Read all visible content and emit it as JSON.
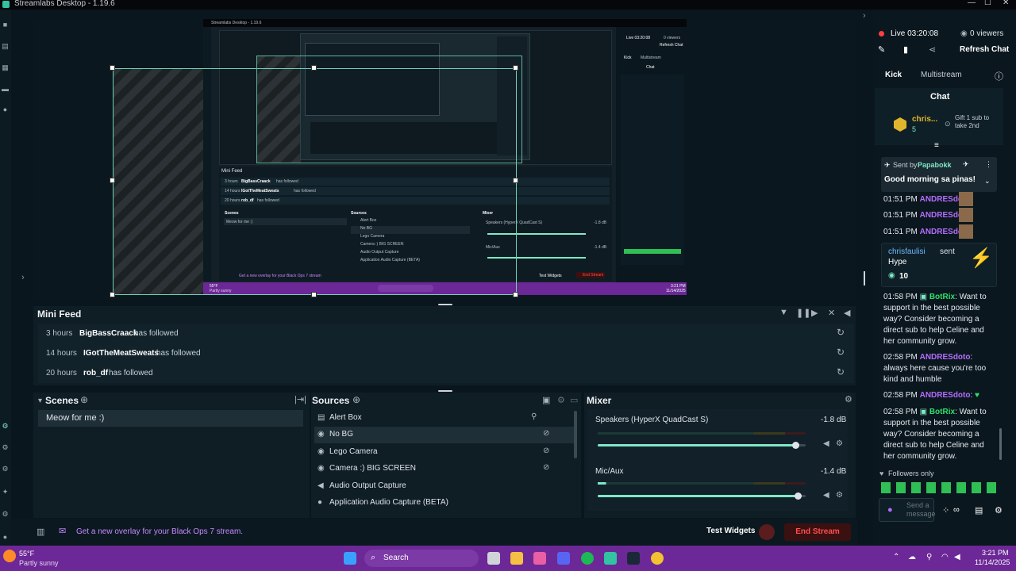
{
  "window": {
    "title": "Streamlabs Desktop - 1.19.6",
    "minimize": "—",
    "maximize": "☐",
    "close": "✕"
  },
  "left_nav": [
    "video-camera",
    "layout",
    "store",
    "themes",
    "monitor"
  ],
  "preview_mini": {
    "title": "Streamlabs Desktop - 1.19.6",
    "mini_feed": "Mini Feed",
    "rows": [
      {
        "time": "3 hours",
        "name": "BigBassCraack",
        "action": "has followed"
      },
      {
        "time": "14 hours",
        "name": "IGotTheMeatSweats",
        "action": "has followed"
      },
      {
        "time": "20 hours",
        "name": "rob_df",
        "action": "has followed"
      }
    ],
    "scenes": "Scenes",
    "scene_item": "Meow for me :)",
    "sources": "Sources",
    "source_items": [
      "Alert Box",
      "No BG",
      "Lego Camera",
      "Camera :) BIG SCREEN",
      "Audio Output Capture",
      "Application Audio Capture (BETA)"
    ],
    "mixer": "Mixer",
    "speakers": "Speakers (HyperX QuadCast S)",
    "speakers_db": "-1.8 dB",
    "mic": "Mic/Aux",
    "mic_db": "-1.4 dB",
    "promo": "Get a new overlay for your Black Ops 7 stream",
    "test_widgets": "Test Widgets",
    "end_stream": "End Stream",
    "live": "Live 03:20:08",
    "viewers": "0 viewers",
    "refresh": "Refresh Chat",
    "kick": "Kick",
    "multistream": "Multistream",
    "chat": "Chat",
    "weather": "55°F",
    "weather_desc": "Partly sunny",
    "clock_time": "3:21 PM",
    "clock_date": "11/14/2025"
  },
  "mini_feed": {
    "title": "Mini Feed",
    "rows": [
      {
        "time": "3 hours",
        "name": "BigBassCraack",
        "action": "has followed"
      },
      {
        "time": "14 hours",
        "name": "IGotTheMeatSweats",
        "action": "has followed"
      },
      {
        "time": "20 hours",
        "name": "rob_df",
        "action": "has followed"
      }
    ]
  },
  "scenes": {
    "title": "Scenes",
    "items": [
      "Meow for me :)"
    ]
  },
  "sources": {
    "title": "Sources",
    "items": [
      "Alert Box",
      "No BG",
      "Lego Camera",
      "Camera :) BIG SCREEN",
      "Audio Output Capture",
      "Application Audio Capture (BETA)"
    ]
  },
  "mixer": {
    "title": "Mixer",
    "channels": [
      {
        "name": "Speakers (HyperX QuadCast S)",
        "db": "-1.8 dB",
        "level": 0.95
      },
      {
        "name": "Mic/Aux",
        "db": "-1.4 dB",
        "level": 0.96
      }
    ]
  },
  "bottom": {
    "promo": "Get a new overlay for your Black Ops 7 stream.",
    "test_widgets": "Test Widgets",
    "end_stream": "End Stream"
  },
  "chat_panel": {
    "live": "Live 03:20:08",
    "viewers": "0 viewers",
    "refresh": "Refresh Chat",
    "tabs": [
      "Kick",
      "Multistream"
    ],
    "chat_title": "Chat",
    "top_user": "chris...",
    "top_count": "5",
    "gift": "Gift 1 sub to take 2nd",
    "pinned_by_label": "Sent by",
    "pinned_by": "Papabokk",
    "pinned_text": "Good morning sa pinas!",
    "messages": [
      {
        "time": "01:51 PM",
        "user": "ANDRESdoto",
        "text": ":"
      },
      {
        "time": "01:51 PM",
        "user": "ANDRESdoto",
        "text": ":"
      },
      {
        "time": "01:51 PM",
        "user": "ANDRESdoto",
        "text": ":"
      }
    ],
    "gift_card": {
      "user": "chrisfaulisi",
      "action": "sent",
      "item": "Hype",
      "amount": "10"
    },
    "later": [
      {
        "time": "01:58 PM",
        "user": "BotRix",
        "text": ": Want to support in the best possible way? Consider becoming a direct sub to help Celine and her community grow."
      },
      {
        "time": "02:58 PM",
        "user": "ANDRESdoto",
        "text": ": always here cause you're too kind and humble"
      },
      {
        "time": "02:58 PM",
        "user": "ANDRESdoto",
        "text": ":"
      },
      {
        "time": "02:58 PM",
        "user": "BotRix",
        "text": ": Want to support in the best possible way? Consider becoming a direct sub to help Celine and her community grow."
      }
    ],
    "followers_only": "Followers only",
    "input_placeholder": "Send a message"
  },
  "taskbar": {
    "weather_temp": "55°F",
    "weather_desc": "Partly sunny",
    "search": "Search",
    "time": "3:21 PM",
    "date": "11/14/2025"
  },
  "colors": {
    "accent": "#7fe8c6",
    "chat_user": "#b56cff",
    "taskbar": "#6b2896",
    "end_stream": "#ff4f4f"
  }
}
